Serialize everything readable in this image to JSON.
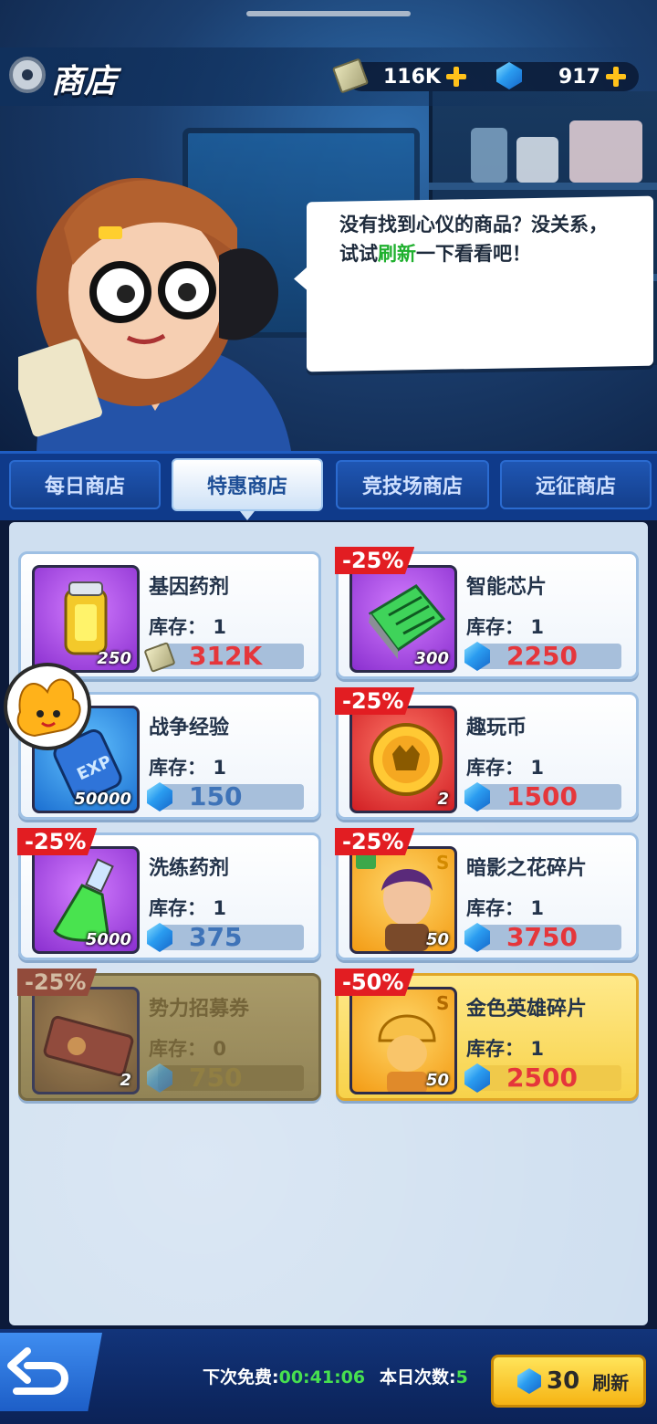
{
  "header": {
    "title": "商店",
    "cash": "116K",
    "gems": "917"
  },
  "speech": {
    "part1": "没有找到心仪的商品？没关系，试试",
    "highlight": "刷新",
    "part2": "一下看看吧！"
  },
  "tabs": [
    {
      "label": "每日商店",
      "active": false
    },
    {
      "label": "特惠商店",
      "active": true
    },
    {
      "label": "竞技场商店",
      "active": false
    },
    {
      "label": "远征商店",
      "active": false
    }
  ],
  "items": [
    {
      "name": "基因药剂",
      "stock_label": "库存：",
      "stock": "1",
      "qty": "250",
      "price": "312K",
      "currency": "cash",
      "discount": ""
    },
    {
      "name": "智能芯片",
      "stock_label": "库存：",
      "stock": "1",
      "qty": "300",
      "price": "2250",
      "currency": "gem",
      "discount": "-25%"
    },
    {
      "name": "战争经验",
      "stock_label": "库存：",
      "stock": "1",
      "qty": "50000",
      "price": "150",
      "currency": "gem",
      "discount": ""
    },
    {
      "name": "趣玩币",
      "stock_label": "库存：",
      "stock": "1",
      "qty": "2",
      "price": "1500",
      "currency": "gem",
      "discount": "-25%"
    },
    {
      "name": "洗练药剂",
      "stock_label": "库存：",
      "stock": "1",
      "qty": "5000",
      "price": "375",
      "currency": "gem",
      "discount": "-25%"
    },
    {
      "name": "暗影之花碎片",
      "stock_label": "库存：",
      "stock": "1",
      "qty": "50",
      "price": "3750",
      "currency": "gem",
      "discount": "-25%"
    },
    {
      "name": "势力招募券",
      "stock_label": "库存：",
      "stock": "0",
      "qty": "2",
      "price": "750",
      "currency": "gem",
      "discount": "-25%"
    },
    {
      "name": "金色英雄碎片",
      "stock_label": "库存：",
      "stock": "1",
      "qty": "50",
      "price": "2500",
      "currency": "gem",
      "discount": "-50%"
    }
  ],
  "footer": {
    "free_label": "下次免费:",
    "free_time": "00:41:06",
    "count_label": "本日次数:",
    "count_value": "5",
    "refresh_cost": "30",
    "refresh_label": "刷新"
  }
}
